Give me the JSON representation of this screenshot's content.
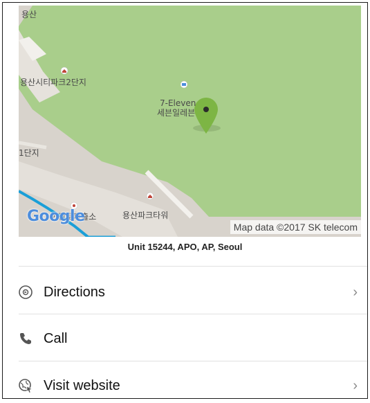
{
  "map": {
    "labels": {
      "top_left": "용산",
      "park_complex": "용산시티파크2단지",
      "store": "7-Eleven",
      "store_korean": "세븐일레븐",
      "complex_1": "1단지",
      "police_box": "한강로파출소",
      "park_tower": "용산파크타워"
    },
    "logo_text": "Google",
    "attribution": "Map data ©2017 SK telecom",
    "pin_color": "#7db544",
    "park_color": "#a9ce8b",
    "road_color": "#1a9fd8"
  },
  "address": "Unit 15244, APO, AP, Seoul",
  "actions": [
    {
      "label": "Directions",
      "icon": "directions-icon",
      "chevron": "›"
    },
    {
      "label": "Call",
      "icon": "phone-icon"
    },
    {
      "label": "Visit website",
      "icon": "website-icon",
      "chevron": "›"
    }
  ]
}
